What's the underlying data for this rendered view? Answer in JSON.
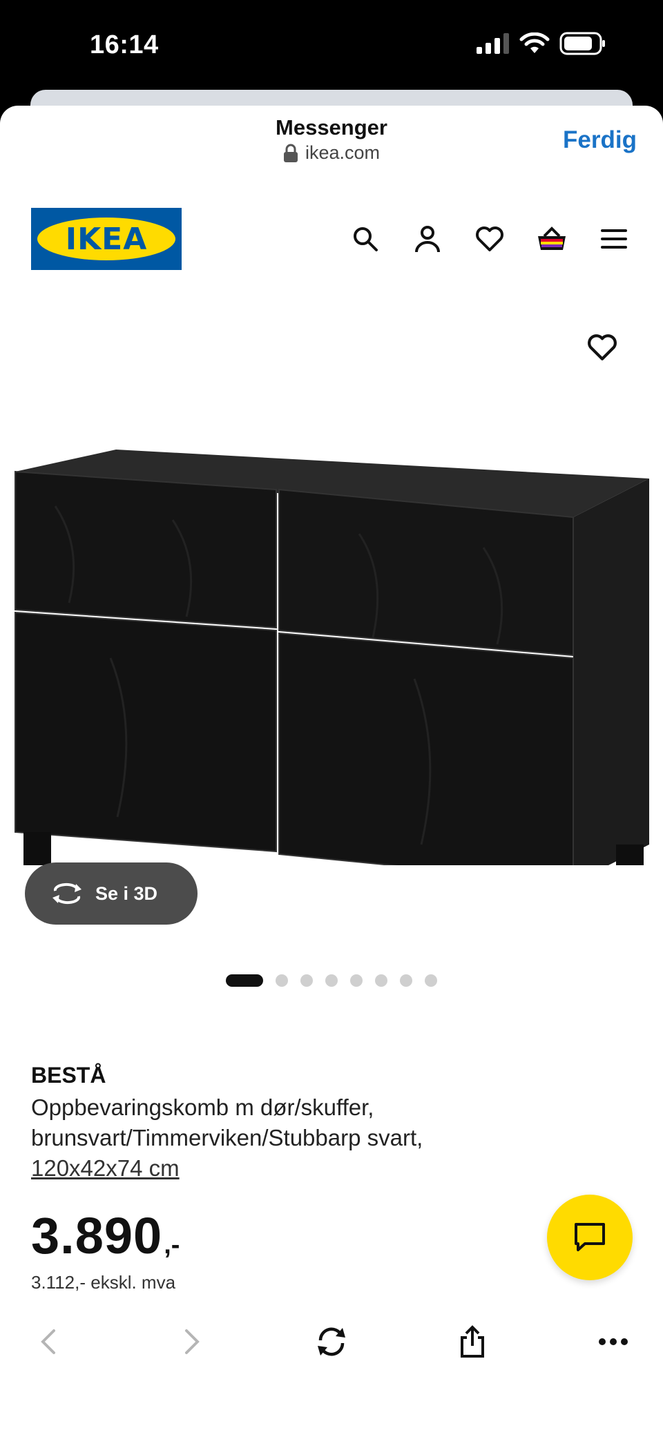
{
  "status": {
    "time": "16:14"
  },
  "browser": {
    "title": "Messenger",
    "url": "ikea.com",
    "done_label": "Ferdig"
  },
  "site": {
    "logo_text": "IKEA",
    "brand_colors": {
      "blue": "#0058a3",
      "yellow": "#ffdb00"
    },
    "nav_icons": [
      "search-icon",
      "account-icon",
      "heart-icon",
      "basket-icon",
      "menu-icon"
    ]
  },
  "gallery": {
    "view_3d_label": "Se i 3D",
    "total_images": 8,
    "active_index": 0
  },
  "product": {
    "name": "BESTÅ",
    "description_line1": "Oppbevaringskomb m dør/skuffer,",
    "description_line2": "brunsvart/Timmerviken/Stubbarp svart,",
    "size": "120x42x74 cm",
    "price": "3.890",
    "price_suffix": ",-",
    "price_ex_vat": "3.112,- ekskl. mva"
  },
  "toolbar": {
    "icons": [
      "back-icon",
      "forward-icon",
      "reload-icon",
      "share-icon",
      "more-icon"
    ]
  }
}
